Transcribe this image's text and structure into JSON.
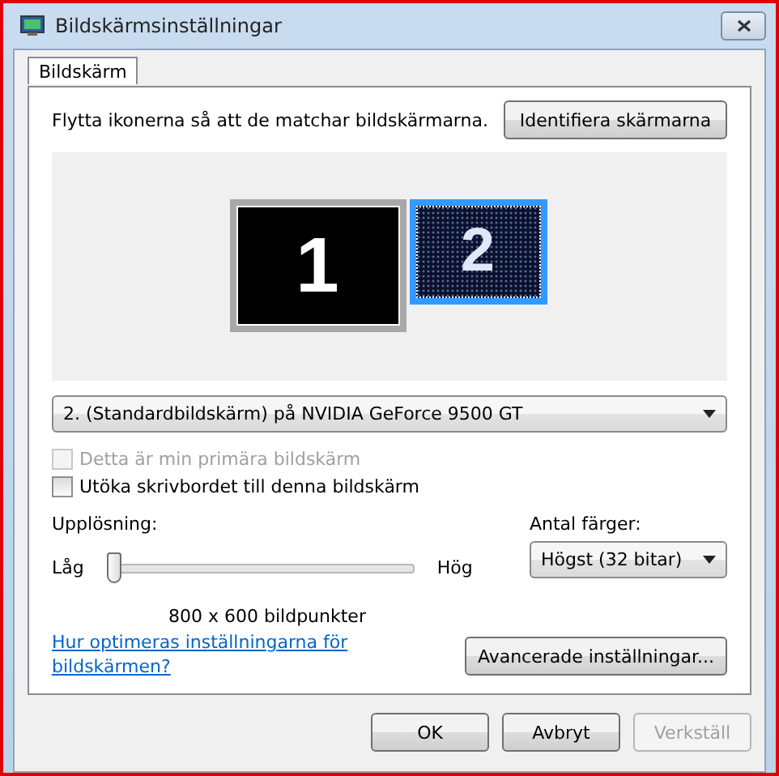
{
  "window": {
    "title": "Bildskärmsinställningar"
  },
  "tabs": [
    {
      "label": "Bildskärm",
      "selected": true
    }
  ],
  "instruction": "Flytta ikonerna så att de matchar bildskärmarna.",
  "identify_button": "Identifiera skärmarna",
  "monitors": [
    {
      "label": "1",
      "selected": false
    },
    {
      "label": "2",
      "selected": true
    }
  ],
  "display_select": {
    "value": "2. (Standardbildskärm) på NVIDIA GeForce 9500 GT"
  },
  "checkboxes": [
    {
      "label": "Detta är min primära bildskärm",
      "checked": false,
      "disabled": true
    },
    {
      "label": "Utöka skrivbordet till denna bildskärm",
      "checked": false,
      "disabled": false
    }
  ],
  "resolution": {
    "label": "Upplösning:",
    "low": "Låg",
    "high": "Hög",
    "level": 0,
    "reading": "800 x 600 bildpunkter"
  },
  "colors": {
    "label": "Antal färger:",
    "value": "Högst (32 bitar)"
  },
  "help_link": "Hur optimeras inställningarna för bildskärmen?",
  "advanced_button": "Avancerade inställningar...",
  "buttons": [
    {
      "label": "OK",
      "disabled": false
    },
    {
      "label": "Avbryt",
      "disabled": false
    },
    {
      "label": "Verkställ",
      "disabled": true
    }
  ]
}
